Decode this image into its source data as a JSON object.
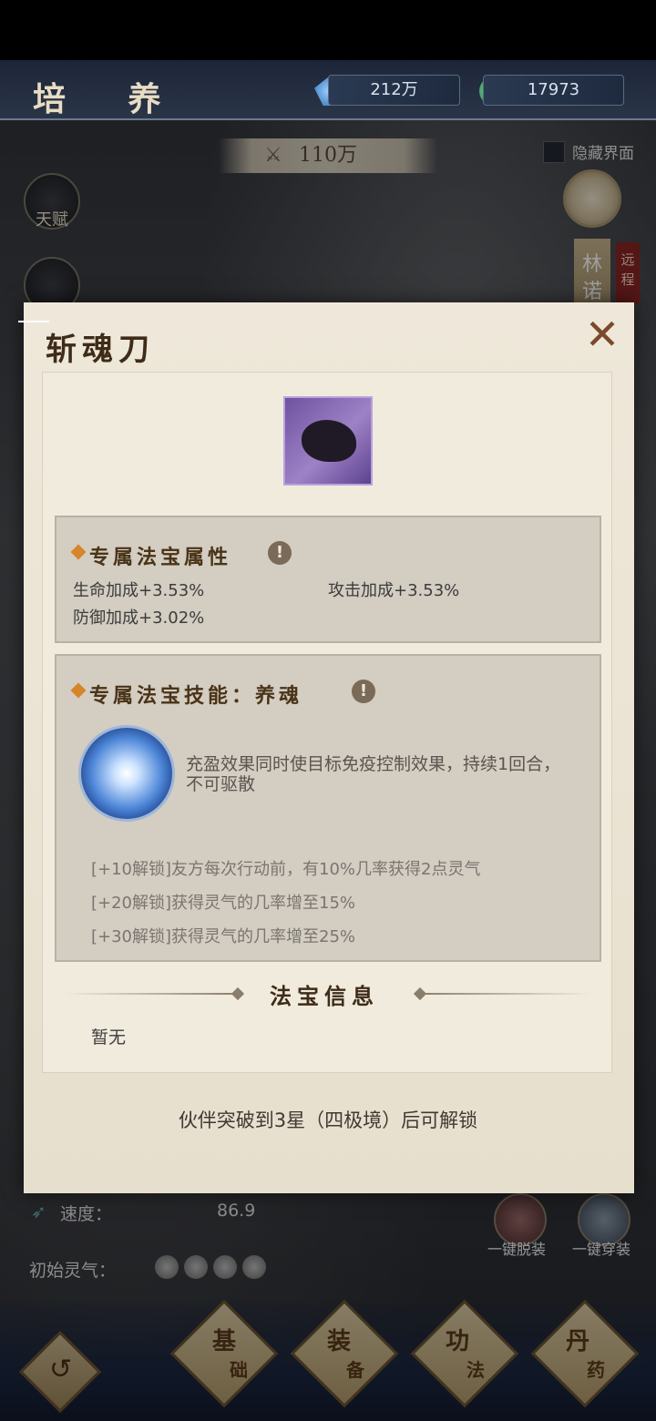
{
  "header": {
    "title": "培 养",
    "currencies": [
      {
        "icon": "crystal-icon",
        "value": "212万"
      },
      {
        "icon": "jade-coin-icon",
        "value": "17973"
      }
    ],
    "power": "110万",
    "hide_ui_label": "隐藏界面"
  },
  "side": {
    "talent_label": "天赋"
  },
  "character": {
    "name": "林诺",
    "tag": "远程"
  },
  "modal": {
    "title": "斩魂刀",
    "item_icon": "cauldron-silhouette-icon",
    "attributes": {
      "heading": "专属法宝属性",
      "info": "!",
      "items": [
        "生命加成+3.53%",
        "攻击加成+3.53%",
        "防御加成+3.02%"
      ]
    },
    "skill": {
      "heading": "专属法宝技能：养魂",
      "info": "!",
      "description": "充盈效果同时使目标免疫控制效果，持续1回合，不可驱散",
      "unlocks": [
        "[+10解锁]友方每次行动前，有10%几率获得2点灵气",
        "[+20解锁]获得灵气的几率增至15%",
        "[+30解锁]获得灵气的几率增至25%"
      ]
    },
    "info_section": {
      "heading": "法宝信息",
      "body": "暂无"
    },
    "footer": "伙伴突破到3星（四极境）后可解锁",
    "close": "✕"
  },
  "stats": {
    "speed_label": "速度：",
    "speed_value": "86.9",
    "qi_label": "初始灵气："
  },
  "gear_actions": {
    "unequip_all": "一键脱装",
    "equip_all": "一键穿装"
  },
  "nav": {
    "tabs": [
      {
        "label_a": "基",
        "label_b": "础"
      },
      {
        "label_a": "装",
        "label_b": "备"
      },
      {
        "label_a": "功",
        "label_b": "法"
      },
      {
        "label_a": "丹",
        "label_b": "药"
      }
    ]
  }
}
